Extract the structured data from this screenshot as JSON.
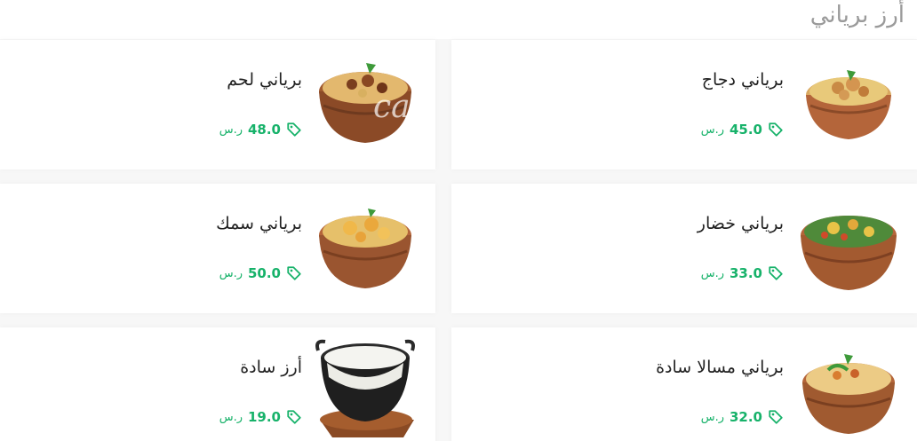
{
  "section": {
    "title": "أرز برياني"
  },
  "watermark": "cal",
  "items": [
    {
      "name": "برياني دجاج",
      "price": "45.0",
      "currency": "ر.س",
      "image": "chicken-biryani-bowl"
    },
    {
      "name": "برياني لحم",
      "price": "48.0",
      "currency": "ر.س",
      "image": "meat-biryani-bowl"
    },
    {
      "name": "برياني خضار",
      "price": "33.0",
      "currency": "ر.س",
      "image": "vegetable-biryani-bowl"
    },
    {
      "name": "برياني سمك",
      "price": "50.0",
      "currency": "ر.س",
      "image": "fish-biryani-bowl"
    },
    {
      "name": "برياني مسالا سادة",
      "price": "32.0",
      "currency": "ر.س",
      "image": "masala-biryani-bowl"
    },
    {
      "name": "أرز سادة",
      "price": "19.0",
      "currency": "ر.س",
      "image": "plain-rice-bowl"
    }
  ],
  "colors": {
    "price": "#17b26a",
    "title": "#9a9a9a",
    "copper": "#b4653a",
    "rice": "#e8c97a"
  }
}
